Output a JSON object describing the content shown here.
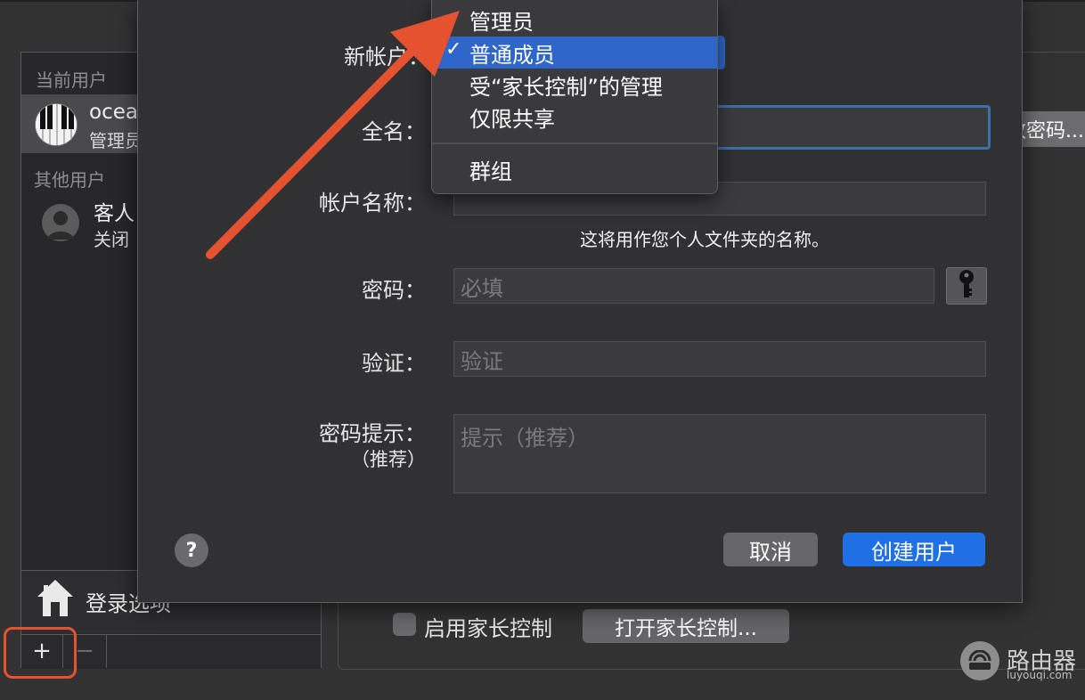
{
  "background": {
    "sidebar": {
      "current_users_header": "当前用户",
      "current_user": {
        "name": "ocea",
        "role": "管理员"
      },
      "other_users_header": "其他用户",
      "guest_user": {
        "name": "客人",
        "status": "关闭"
      },
      "login_options_label": "登录选项",
      "add_label": "+",
      "remove_label": "−"
    },
    "change_password_button": "更改密码...",
    "parental_control_checkbox_label": "启用家长控制",
    "open_parental_control_button": "打开家长控制..."
  },
  "sheet": {
    "new_account_label": "新帐户：",
    "full_name_label": "全名：",
    "account_name_label": "帐户名称：",
    "account_name_hint": "这将用作您个人文件夹的名称。",
    "password_label": "密码：",
    "password_placeholder": "必填",
    "verify_label": "验证：",
    "verify_placeholder": "验证",
    "hint_label": "密码提示：",
    "hint_label_sub": "（推荐）",
    "hint_placeholder": "提示（推荐）",
    "help_label": "?",
    "cancel_button": "取消",
    "create_button": "创建用户"
  },
  "account_type_menu": {
    "items": [
      "管理员",
      "普通成员",
      "受“家长控制”的管理",
      "仅限共享",
      "群组"
    ],
    "selected": "普通成员",
    "check_mark": "✓"
  },
  "colors": {
    "accent_blue": "#1f6fe5",
    "annotation_red": "#e4522f"
  },
  "watermark": {
    "title": "路由器",
    "url": "luyouqi.com"
  }
}
